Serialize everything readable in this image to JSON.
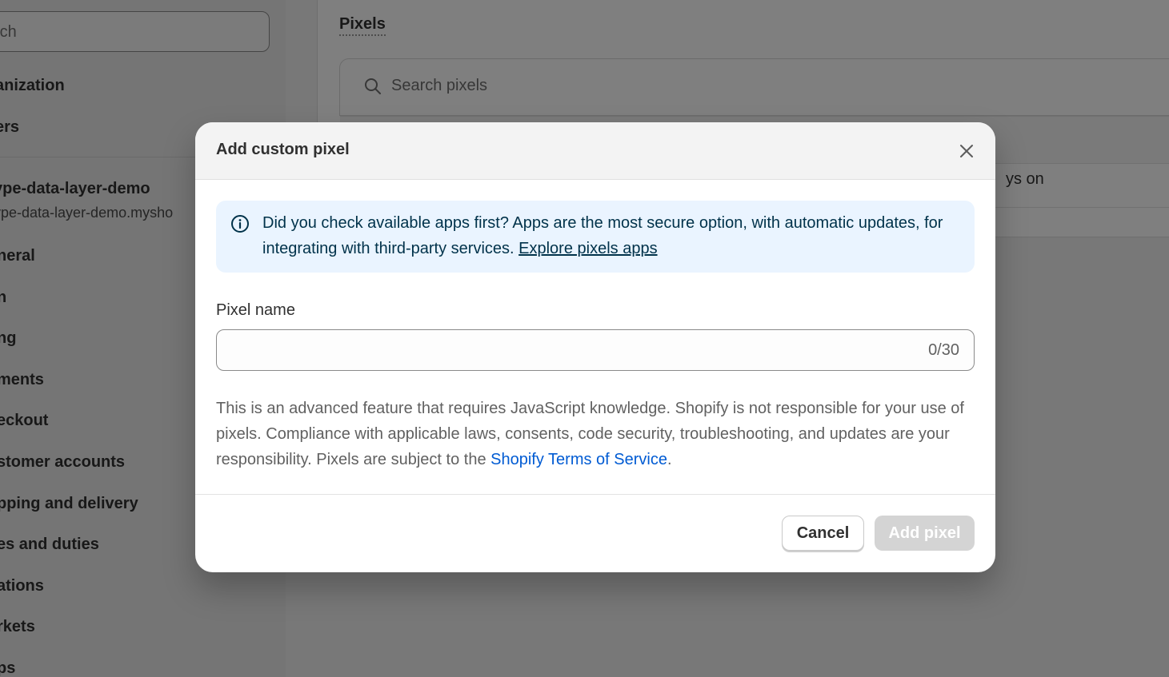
{
  "sidebar": {
    "search_placeholder": "rch",
    "items_top": [
      "anization",
      "ers"
    ],
    "store_name": "ype-data-layer-demo",
    "store_url": "ype-data-layer-demo.mysho",
    "nav": [
      "neral",
      "n",
      "ng",
      "ments",
      "eckout",
      "stomer accounts",
      "pping and delivery",
      "es and duties",
      "ations",
      "rkets",
      "ps"
    ]
  },
  "main": {
    "section_title": "Pixels",
    "search_placeholder": "Search pixels",
    "row_status": "ys on"
  },
  "modal": {
    "title": "Add custom pixel",
    "close_icon": "close-icon",
    "banner": {
      "icon": "info-icon",
      "text": "Did you check available apps first? Apps are the most secure option, with automatic updates, for integrating with third-party services. ",
      "link": "Explore pixels apps"
    },
    "field": {
      "label": "Pixel name",
      "value": "",
      "counter": "0/30"
    },
    "disclaimer": {
      "text": "This is an advanced feature that requires JavaScript knowledge. Shopify is not responsible for your use of pixels. Compliance with applicable laws, consents, code security, troubleshooting, and updates are your responsibility. Pixels are subject to the ",
      "link": "Shopify Terms of Service",
      "suffix": "."
    },
    "buttons": {
      "cancel": "Cancel",
      "add": "Add pixel"
    }
  },
  "colors": {
    "overlay": "#000000",
    "banner_bg": "#eaf4ff",
    "link": "#005bd3",
    "disabled_button": "#d4d4d4"
  }
}
